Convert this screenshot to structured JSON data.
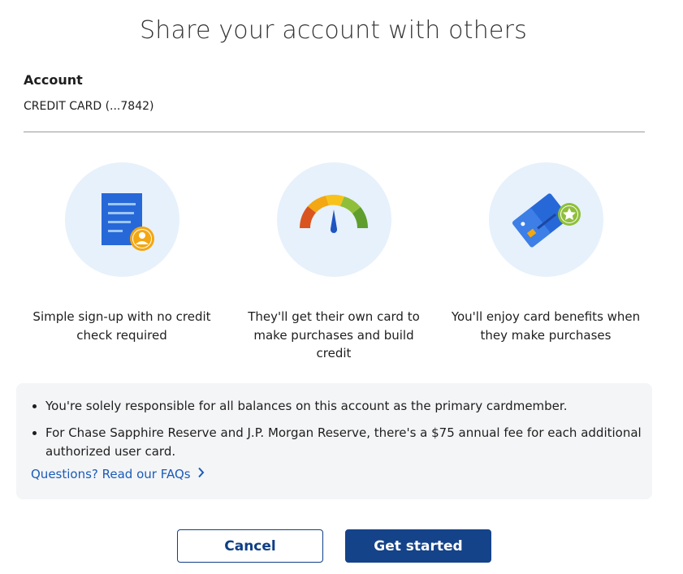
{
  "page": {
    "title": "Share your account with others"
  },
  "account": {
    "label": "Account",
    "value": "CREDIT CARD (...7842)"
  },
  "features": [
    {
      "icon": "document-user-icon",
      "text": "Simple sign-up with no credit check required"
    },
    {
      "icon": "credit-gauge-icon",
      "text": "They'll get their own card to make purchases and build credit"
    },
    {
      "icon": "card-star-icon",
      "text": "You'll enjoy card benefits when they make purchases"
    }
  ],
  "info": {
    "bullets": [
      "You're solely responsible for all balances on this account as the primary cardmember.",
      "For Chase Sapphire Reserve and J.P. Morgan Reserve, there's a $75 annual fee for each additional authorized user card."
    ],
    "faq_link": "Questions? Read our FAQs"
  },
  "buttons": {
    "cancel": "Cancel",
    "start": "Get started"
  },
  "colors": {
    "primary": "#154389",
    "link": "#1a5bb8",
    "circle_bg": "#e6f1fb",
    "panel_bg": "#f4f5f7"
  }
}
